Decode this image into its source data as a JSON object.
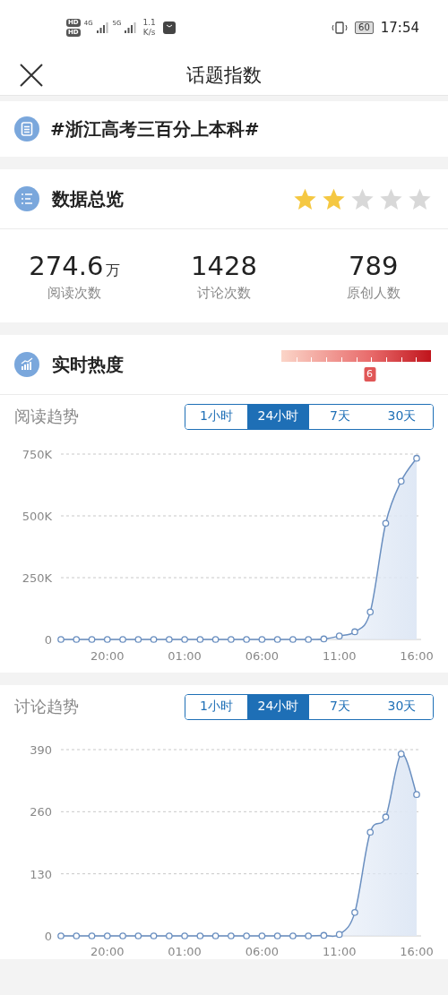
{
  "status_bar": {
    "hd_badges": [
      "HD",
      "HD"
    ],
    "networks": [
      "4G",
      "5G"
    ],
    "speed_value": "1.1",
    "speed_unit": "K/s",
    "battery": "60",
    "time": "17:54"
  },
  "header": {
    "title": "话题指数"
  },
  "topic": {
    "title": "#浙江高考三百分上本科#"
  },
  "overview": {
    "title": "数据总览",
    "stars": 2,
    "stats": [
      {
        "value": "274.6",
        "unit": "万",
        "label": "阅读次数"
      },
      {
        "value": "1428",
        "label": "讨论次数"
      },
      {
        "value": "789",
        "label": "原创人数"
      }
    ]
  },
  "heat": {
    "title": "实时热度",
    "level": 0.59,
    "reading": "6"
  },
  "trends": [
    {
      "title": "阅读趋势",
      "tabs": [
        {
          "label": "1小时",
          "selected": false
        },
        {
          "label": "24小时",
          "selected": true
        },
        {
          "label": "7天",
          "selected": false
        },
        {
          "label": "30天",
          "selected": false
        }
      ],
      "chart_data": {
        "type": "area",
        "categories": [
          null,
          null,
          null,
          "20:00",
          null,
          null,
          null,
          null,
          "01:00",
          null,
          null,
          null,
          null,
          "06:00",
          null,
          null,
          null,
          null,
          "11:00",
          null,
          null,
          null,
          null,
          "16:00"
        ],
        "series": [
          {
            "color": "#6a8fc0",
            "values": [
              0,
              0,
              0,
              0,
              0,
              0,
              0,
              0,
              0,
              0,
              0,
              0,
              0,
              0,
              0,
              0,
              0,
              2000,
              14000,
              31000,
              111000,
              470000,
              640000,
              733000
            ]
          }
        ],
        "ylim": [
          0,
          750000
        ],
        "yticks": [
          {
            "value": 0,
            "label": "0"
          },
          {
            "value": 250000,
            "label": "250K"
          },
          {
            "value": 500000,
            "label": "500K"
          },
          {
            "value": 750000,
            "label": "750K"
          }
        ]
      }
    },
    {
      "title": "讨论趋势",
      "tabs": [
        {
          "label": "1小时",
          "selected": false
        },
        {
          "label": "24小时",
          "selected": true
        },
        {
          "label": "7天",
          "selected": false
        },
        {
          "label": "30天",
          "selected": false
        }
      ],
      "chart_data": {
        "type": "area",
        "categories": [
          null,
          null,
          null,
          "20:00",
          null,
          null,
          null,
          null,
          "01:00",
          null,
          null,
          null,
          null,
          "06:00",
          null,
          null,
          null,
          null,
          "11:00",
          null,
          null,
          null,
          null,
          "16:00"
        ],
        "series": [
          {
            "color": "#6a8fc0",
            "values": [
              0,
              0,
              0,
              0,
              0,
              0,
              0,
              0,
              0,
              0,
              0,
              0,
              0,
              0,
              0,
              0,
              0,
              1,
              3,
              49,
              217,
              249,
              381,
              296
            ]
          }
        ],
        "ylim": [
          0,
          390
        ],
        "yticks": [
          {
            "value": 0,
            "label": "0"
          },
          {
            "value": 130,
            "label": "130"
          },
          {
            "value": 260,
            "label": "260"
          },
          {
            "value": 390,
            "label": "390"
          }
        ]
      }
    }
  ]
}
